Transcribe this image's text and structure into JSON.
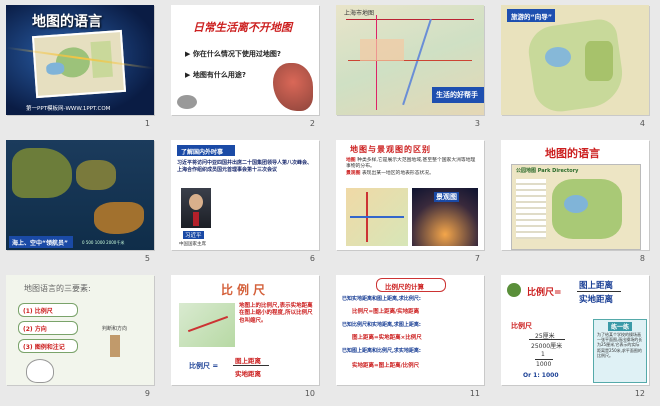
{
  "slides": [
    {
      "n": "1",
      "title": "地图的语言",
      "site": "第一PPT模板网-WWW.1PPT.COM"
    },
    {
      "n": "2",
      "title": "日常生活离不开地图",
      "q1": "你在什么情况下使用过地图?",
      "q2": "地图有什么用途?"
    },
    {
      "n": "3",
      "map_title": "上海市地图",
      "caption": "生活的好帮手"
    },
    {
      "n": "4",
      "label": "旅游的“向导”"
    },
    {
      "n": "5",
      "caption": "海上、空中“领航员”",
      "scale": "0 500 1000 2000千米"
    },
    {
      "n": "6",
      "tag": "了解国内外时事",
      "text1": "习近平将访问中亚四国并出席二十国集团领导人第八次峰会、上海合作组织成员国元首理事会第十三次会议",
      "name": "习近平",
      "role": "中国国家主席"
    },
    {
      "n": "7",
      "title": "地图与景观图的区别",
      "body1": "地图",
      "body2": "种类多样,它是展示大范围地域,甚至整个国家大洲等地理事物的分布。",
      "body3": "景观图",
      "body4": "表现出某一地区的地表形态状况。",
      "photo_label": "景观图"
    },
    {
      "n": "8",
      "title": "地图的语言",
      "legend_title": "公园地图 Park Directory"
    },
    {
      "n": "9",
      "title": "地图语言的三要素:",
      "items": [
        "(1) 比例尺",
        "(2) 方向",
        "(3) 图例和注记"
      ],
      "note": "判断和方向"
    },
    {
      "n": "10",
      "title": "比例尺",
      "desc": "地图上的比例尺,表示实地距离在图上缩小的程度,所以比例尺也叫缩尺。",
      "formula_left": "比例尺 =",
      "num": "图上距离",
      "den": "实地距离"
    },
    {
      "n": "11",
      "title": "比例尺的计算",
      "lines": [
        "已知实地距离和图上距离,求比例尺:",
        "比例尺=图上距离/实地距离",
        "已知比例尺和实地距离,求图上距离:",
        "图上距离=实地距离×比例尺",
        "已知图上距离和比例尺,求实地距离:",
        "实地距离=图上距离/比例尺"
      ]
    },
    {
      "n": "12",
      "formula_left": "比例尺=",
      "num": "图上距离",
      "den": "实地距离",
      "sub": "比例尺",
      "v1": "25厘米",
      "v2": "25000厘米",
      "v3": "1",
      "v4": "1000",
      "ratio": "Or 1: 1000",
      "practice": "练一练",
      "practice_text": "为了给某个学校的操场画一张平面图,画出操场的长为25厘米,它表示的实际距离是250米,求平面图的比例尺。"
    }
  ],
  "colors": {
    "pageBg": "#e9e9e9",
    "red": "#cc1f1f",
    "blue": "#1a3f95",
    "navy": "#0c2a6b"
  }
}
